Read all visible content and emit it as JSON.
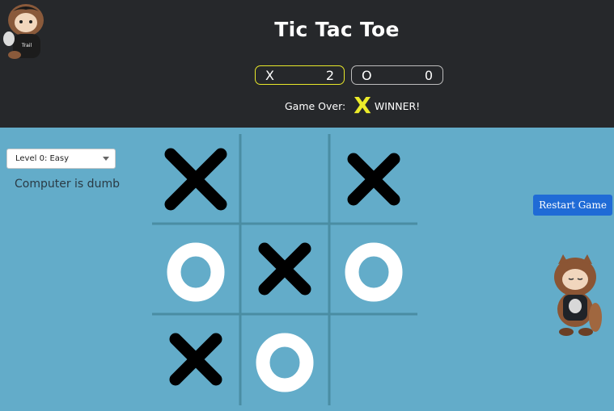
{
  "header": {
    "title": "Tic Tac Toe",
    "scores": [
      {
        "player": "X",
        "score": "2"
      },
      {
        "player": "O",
        "score": "0"
      }
    ],
    "status_label": "Game Over:",
    "winner_mark": "X",
    "winner_text": "WINNER!"
  },
  "controls": {
    "level_select": "Level 0: Easy",
    "level_hint": "Computer is dumb",
    "restart_label": "Restart Game"
  },
  "board": {
    "cells": [
      "X",
      "",
      "X",
      "O",
      "X",
      "O",
      "X",
      "O",
      ""
    ]
  },
  "colors": {
    "background": "#63acc9",
    "header_bg": "#26282b",
    "winner_yellow": "#ecec2a",
    "button_blue": "#1f6bd6"
  },
  "icons": {
    "top_left": "astro-mascot-icon",
    "right": "astro-mascot-icon"
  }
}
